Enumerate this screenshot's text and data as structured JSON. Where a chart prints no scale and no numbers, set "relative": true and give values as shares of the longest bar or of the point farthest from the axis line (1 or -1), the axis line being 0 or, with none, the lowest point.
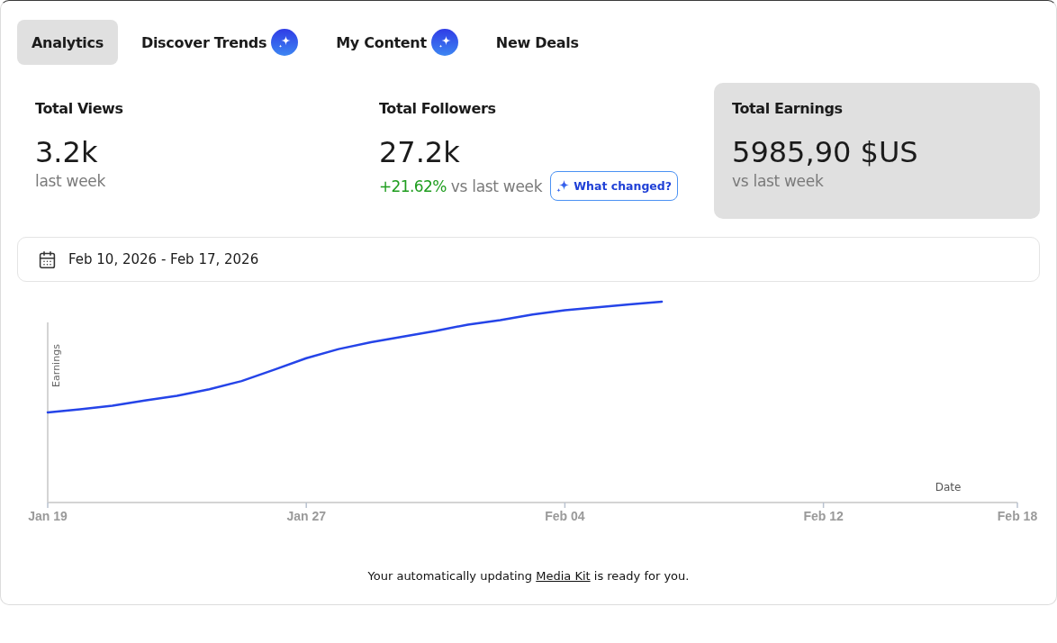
{
  "tabs": [
    {
      "label": "Analytics",
      "selected": true,
      "ai_badge": false
    },
    {
      "label": "Discover Trends",
      "selected": false,
      "ai_badge": true
    },
    {
      "label": "My Content",
      "selected": false,
      "ai_badge": true
    },
    {
      "label": "New Deals",
      "selected": false,
      "ai_badge": false
    }
  ],
  "stats": [
    {
      "title": "Total Views",
      "value": "3.2k",
      "caption": "last week",
      "selected": false
    },
    {
      "title": "Total Followers",
      "value": "27.2k",
      "change": "+21.62%",
      "caption": "vs last week",
      "action": "What changed?",
      "selected": false
    },
    {
      "title": "Total Earnings",
      "value": "5985,90 $US",
      "caption": "vs last week",
      "selected": true
    }
  ],
  "date_range": {
    "value": "Feb 10, 2026 - Feb 17, 2026"
  },
  "chart": {
    "chart_data": {
      "type": "line",
      "xlabel": "Date",
      "ylabel": "Earnings",
      "relative": true,
      "categories": [
        "Jan 19",
        null,
        null,
        null,
        null,
        null,
        null,
        null,
        "Jan 27",
        null,
        null,
        null,
        null,
        null,
        null,
        null,
        "Feb 04",
        null,
        null,
        null,
        null,
        null,
        null,
        null,
        "Feb 12",
        null,
        null,
        null,
        null,
        null,
        "Feb 18"
      ],
      "series": [
        {
          "color": "#2544e8",
          "values": [
            0.449,
            0.464,
            0.482,
            0.508,
            0.532,
            0.564,
            0.605,
            0.661,
            0.719,
            0.764,
            0.798,
            0.826,
            0.854,
            0.886,
            0.908,
            0.936,
            0.958,
            0.972,
            0.986,
            1,
            null,
            null,
            null,
            null,
            null,
            null,
            null,
            null,
            null,
            null,
            null
          ]
        }
      ]
    }
  },
  "footer": {
    "before": "Your automatically updating",
    "link": "Media Kit",
    "after": "is ready for you."
  }
}
